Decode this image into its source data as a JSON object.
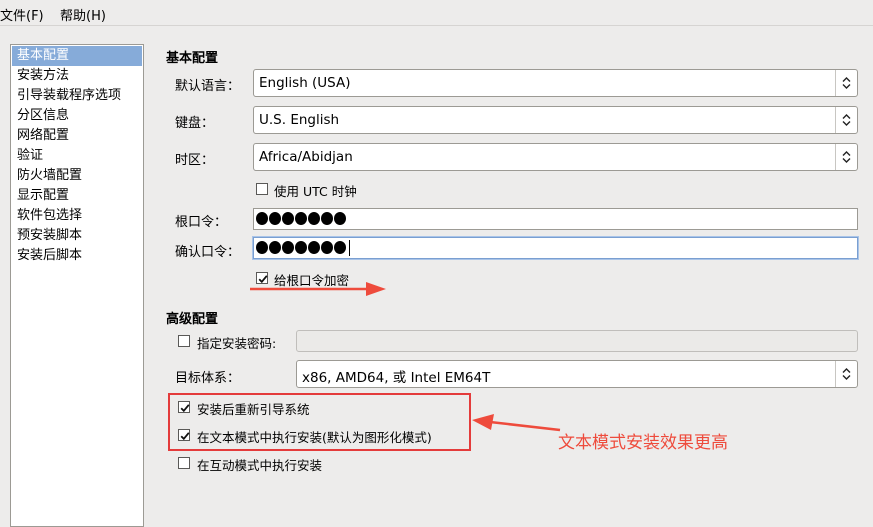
{
  "menubar": {
    "file": "文件(F)",
    "help": "帮助(H)"
  },
  "sidebar": {
    "items": [
      {
        "label": "基本配置",
        "selected": true
      },
      {
        "label": "安装方法"
      },
      {
        "label": "引导装载程序选项"
      },
      {
        "label": "分区信息"
      },
      {
        "label": "网络配置"
      },
      {
        "label": "验证"
      },
      {
        "label": "防火墙配置"
      },
      {
        "label": "显示配置"
      },
      {
        "label": "软件包选择"
      },
      {
        "label": "预安装脚本"
      },
      {
        "label": "安装后脚本"
      }
    ]
  },
  "basic": {
    "title": "基本配置",
    "language_label": "默认语言：",
    "language_value": "English (USA)",
    "keyboard_label": "键盘：",
    "keyboard_value": "U.S. English",
    "timezone_label": "时区：",
    "timezone_value": "Africa/Abidjan",
    "utc_label": "使用 UTC 时钟",
    "utc_checked": false,
    "root_pw_label": "根口令：",
    "root_pw_length": 7,
    "confirm_pw_label": "确认口令：",
    "confirm_pw_length": 7,
    "encrypt_label": "给根口令加密",
    "encrypt_checked": true
  },
  "advanced": {
    "title": "高级配置",
    "install_key_label": "指定安装密码:",
    "install_key_checked": false,
    "install_key_value": "",
    "arch_label": "目标体系：",
    "arch_value": "x86, AMD64, 或 Intel EM64T",
    "reboot_label": "安装后重新引导系统",
    "reboot_checked": true,
    "text_mode_label": "在文本模式中执行安装(默认为图形化模式)",
    "text_mode_checked": true,
    "interactive_label": "在互动模式中执行安装",
    "interactive_checked": false
  },
  "annotation": {
    "text": "文本模式安装效果更高",
    "color": "#ee4b3c"
  }
}
